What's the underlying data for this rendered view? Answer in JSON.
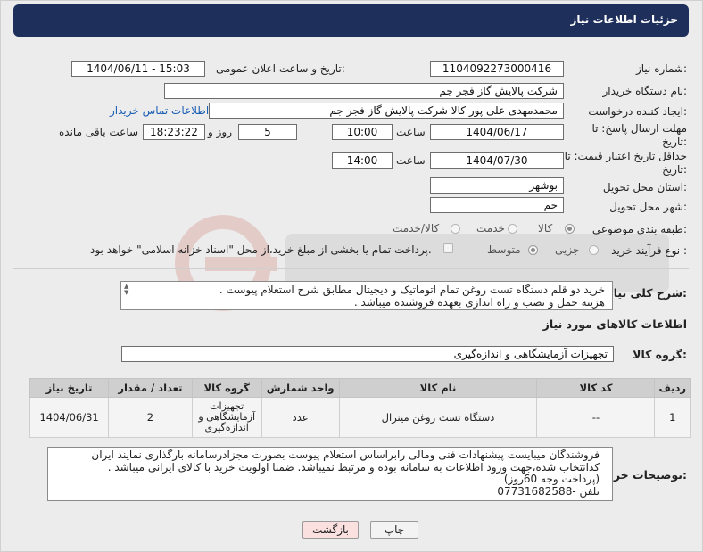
{
  "window_title": "جزئیات اطلاعات نیاز",
  "fields": {
    "need_number_label": "شماره نیاز:",
    "need_number": "1104092273000416",
    "announce_label": "تاریخ و ساعت اعلان عمومی:",
    "announce_value": "1404/06/11 - 15:03",
    "buyer_org_label": "نام دستگاه خریدار:",
    "buyer_org": "شرکت پالایش گاز فجر جم",
    "creator_label": "ایجاد کننده درخواست:",
    "creator": "محمدمهدی علی پور کالا شرکت پالایش گاز فجر جم",
    "contact_link": "اطلاعات تماس خریدار",
    "deadline_label": "مهلت ارسال پاسخ: تا تاریخ:",
    "deadline_date": "1404/06/17",
    "time_label": "ساعت",
    "deadline_time": "10:00",
    "days_value": "5",
    "days_label": "روز و",
    "remaining_time": "18:23:22",
    "remaining_label": "ساعت باقی مانده",
    "validity_label": "حداقل تاریخ اعتبار قیمت: تا تاریخ:",
    "validity_date": "1404/07/30",
    "validity_time": "14:00",
    "province_label": "استان محل تحویل:",
    "province": "بوشهر",
    "city_label": "شهر محل تحویل:",
    "city": "جم",
    "category_label": "طبقه بندی موضوعی:",
    "category_options": [
      "کالا",
      "خدمت",
      "کالا/خدمت"
    ],
    "process_label": "نوع فرآیند خرید :",
    "process_options": [
      "جزیی",
      "متوسط"
    ],
    "payment_note": "پرداخت تمام یا بخشی از مبلغ خرید،از محل \"اسناد خزانه اسلامی\" خواهد بود."
  },
  "description": {
    "label": "شرح کلی نیاز:",
    "lines": [
      "خرید دو قلم دستگاه تست روغن تمام اتوماتیک و دیجیتال مطابق شرح استعلام پیوست .",
      "هزینه حمل و نصب و راه اندازی بعهده فروشنده میباشد ."
    ]
  },
  "goods_section": {
    "title": "اطلاعات کالاهای مورد نیاز",
    "group_label": "گروه کالا:",
    "group_value": "تجهیزات آزمایشگاهی و اندازه‌گیری"
  },
  "table": {
    "headers": [
      "ردیف",
      "کد کالا",
      "نام کالا",
      "واحد شمارش",
      "گروه کالا",
      "تعداد / مقدار",
      "تاریخ نیاز"
    ],
    "rows": [
      {
        "row": "1",
        "code": "--",
        "name": "دستگاه تست روغن مینرال",
        "unit": "عدد",
        "group_lines": [
          "تجهیزات",
          "آزمایشگاهی و",
          "اندازه‌گیری"
        ],
        "qty": "2",
        "date": "1404/06/31"
      }
    ]
  },
  "buyer_notes": {
    "label": "توضیحات خریدار:",
    "lines": [
      "فروشندگان میبایست پیشنهادات فنی ومالی رابراساس استعلام پیوست بصورت مجزادرسامانه بارگذاری نمایند ایران",
      "کدانتخاب شده،جهت ورود اطلاعات به سامانه بوده و مرتبط نمیباشد. ضمنا اولویت خرید با کالای ایرانی میباشد .",
      "(پرداخت وجه 60روز)",
      "تلفن -07731682588"
    ]
  },
  "buttons": {
    "print": "چاپ",
    "back": "بازگشت"
  }
}
